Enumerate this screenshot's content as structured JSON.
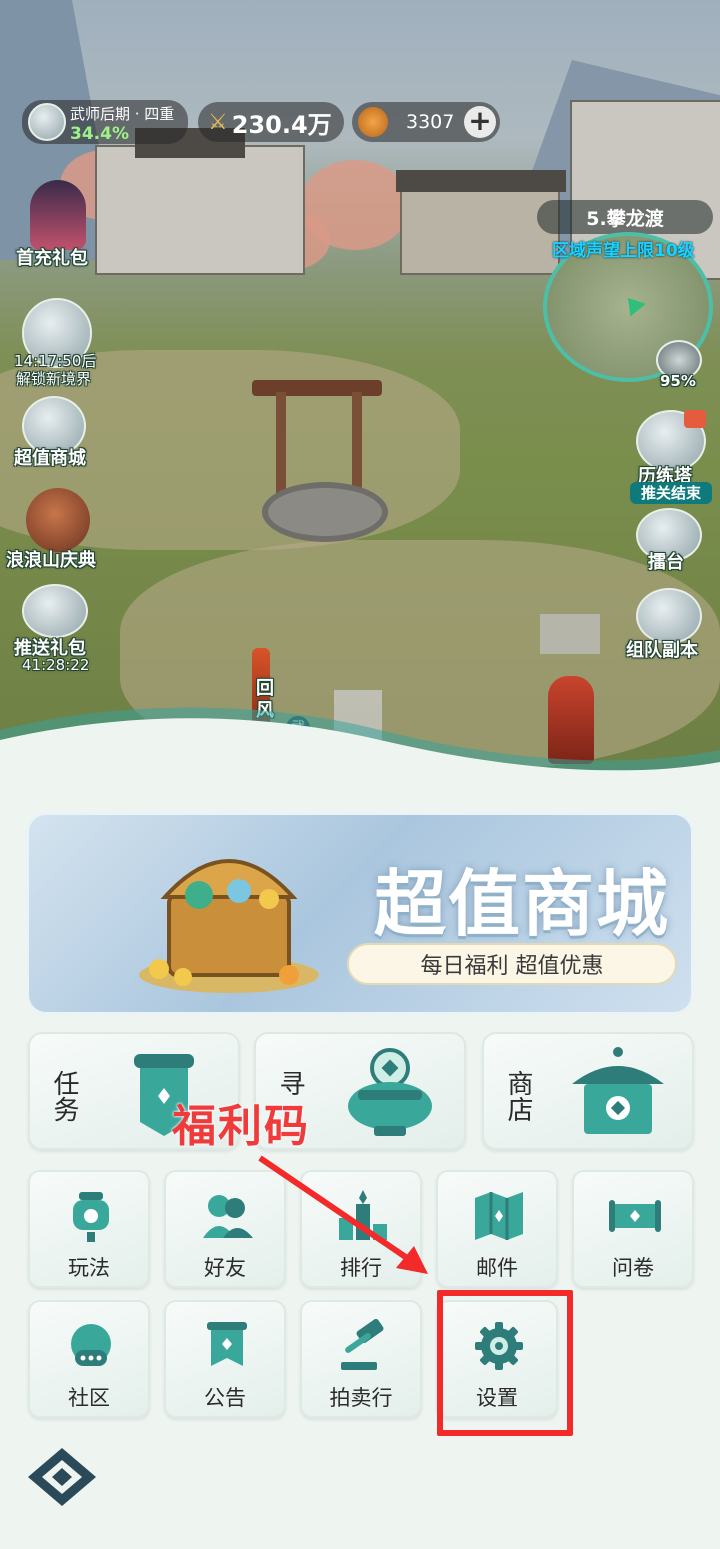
{
  "hud": {
    "level_name": "武师后期 · 四重",
    "level_pct": "34.4%",
    "power": "230.4万",
    "coins": "3307",
    "add_symbol": "+"
  },
  "left_side": {
    "first_pay": "首充礼包",
    "countdown": "14:17:50后",
    "unlock": "解锁新境界",
    "mall": "超值商城",
    "festival": "浪浪山庆典",
    "push_gift": "推送礼包",
    "push_timer": "41:28:22"
  },
  "right_side": {
    "region_name": "5.攀龙渡",
    "region_sub": "区域声望上限10级",
    "map_pct": "95%",
    "tower": "历练塔",
    "tower_status": "推关结束",
    "arena": "擂台",
    "team": "组队副本"
  },
  "scene": {
    "npc1": "回风",
    "npc_tag": "武"
  },
  "banner": {
    "title": "超值商城",
    "subtitle": "每日福利 超值优惠"
  },
  "big_tiles": [
    {
      "label": "任务"
    },
    {
      "label": "寻"
    },
    {
      "label": "商店"
    }
  ],
  "tiles_row1": [
    "玩法",
    "好友",
    "排行",
    "邮件",
    "问卷"
  ],
  "tiles_row2": [
    "社区",
    "公告",
    "拍卖行",
    "设置"
  ],
  "annotation": {
    "text": "福利码",
    "color": "#ef3b3b"
  },
  "colors": {
    "accent_teal": "#2e7d7b",
    "highlight_red": "#f22a2a"
  }
}
